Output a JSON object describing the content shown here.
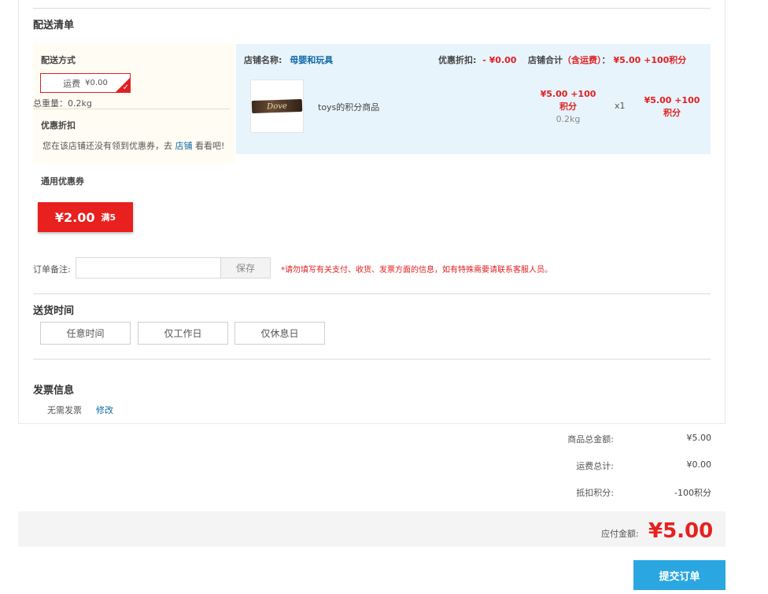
{
  "section_title": "配送清单",
  "delivery": {
    "method_title": "配送方式",
    "shipping_label": "运费",
    "shipping_value": "¥0.00",
    "weight_text": "总重量：0.2kg",
    "discount_title": "优惠折扣",
    "discount_msg_prefix": "您在该店铺还没有领到优惠券，去",
    "discount_msg_link": "店铺",
    "discount_msg_suffix": "看看吧!"
  },
  "store": {
    "name_label": "店铺名称:",
    "name": "母婴和玩具",
    "discount_label": "优惠折扣:",
    "discount_value": "- ¥0.00",
    "total_label": "店铺合计",
    "total_paren": "（含运费）",
    "total_colon": "：",
    "total_value": "¥5.00 +100积分",
    "product": {
      "name": "toys的积分商品",
      "logo_text": "Dove",
      "price_line1": "¥5.00 +100",
      "price_line2": "积分",
      "weight": "0.2kg",
      "qty": "x1",
      "subtotal_line1": "¥5.00 +100",
      "subtotal_line2": "积分"
    }
  },
  "coupon": {
    "title": "通用优惠券",
    "amount": "¥2.00",
    "condition": "满5"
  },
  "note": {
    "label": "订单备注:",
    "value": "",
    "placeholder": "",
    "save_label": "保存",
    "warning": "*请勿填写有关支付、收货、发票方面的信息，如有特殊需要请联系客服人员。"
  },
  "delivery_time": {
    "title": "送货时间",
    "options": [
      "任意时间",
      "仅工作日",
      "仅休息日"
    ]
  },
  "invoice": {
    "title": "发票信息",
    "status": "无需发票",
    "edit_label": "修改"
  },
  "summary": {
    "goods_total_label": "商品总金额:",
    "goods_total_value": "¥5.00",
    "shipping_total_label": "运费总计:",
    "shipping_total_value": "¥0.00",
    "points_label": "抵扣积分:",
    "points_value": "-100积分",
    "payable_label": "应付金额:",
    "payable_value": "¥5.00"
  },
  "submit_label": "提交订单",
  "colors": {
    "accent_red": "#e02020",
    "link_blue": "#0e6aa8",
    "submit_blue": "#2aa7e1",
    "store_bg": "#e8f4fc",
    "delivery_bg": "#fffdf3"
  }
}
